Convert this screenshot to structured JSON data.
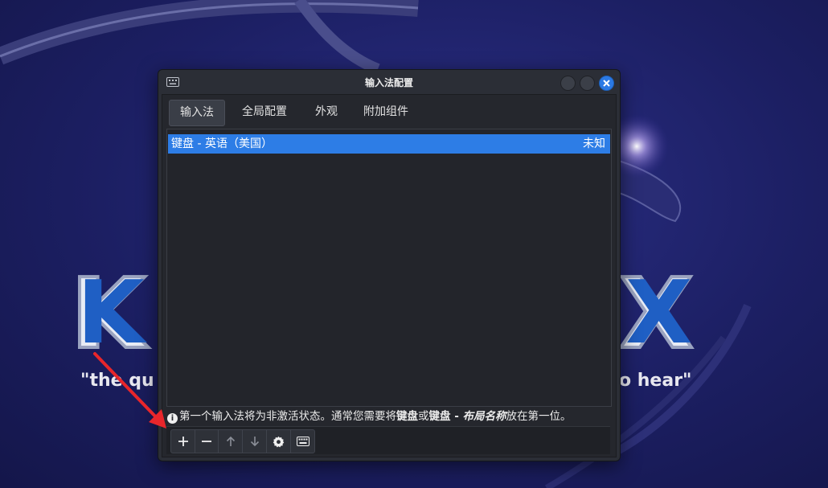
{
  "window": {
    "title": "输入法配置"
  },
  "tabs": [
    {
      "label": "输入法",
      "active": true
    },
    {
      "label": "全局配置",
      "active": false
    },
    {
      "label": "外观",
      "active": false
    },
    {
      "label": "附加组件",
      "active": false
    }
  ],
  "input_methods": [
    {
      "name": "键盘 - 英语（美国）",
      "status": "未知",
      "selected": true
    }
  ],
  "hint": {
    "icon": "info-icon",
    "prefix": "第一个输入法将为非激活状态。通常您需要将",
    "bold1": "键盘",
    "mid": "或",
    "bold2": "键盘 - ",
    "italic": "布局名称",
    "suffix": "放在第一位。"
  },
  "toolbar": {
    "icons": [
      "add-icon",
      "remove-icon",
      "move-up-icon",
      "move-down-icon",
      "configure-icon",
      "keyboard-layout-icon"
    ]
  },
  "colors": {
    "accent": "#2d7de6",
    "window_bg": "#2b2e36",
    "annotation_arrow": "#e8262b"
  }
}
